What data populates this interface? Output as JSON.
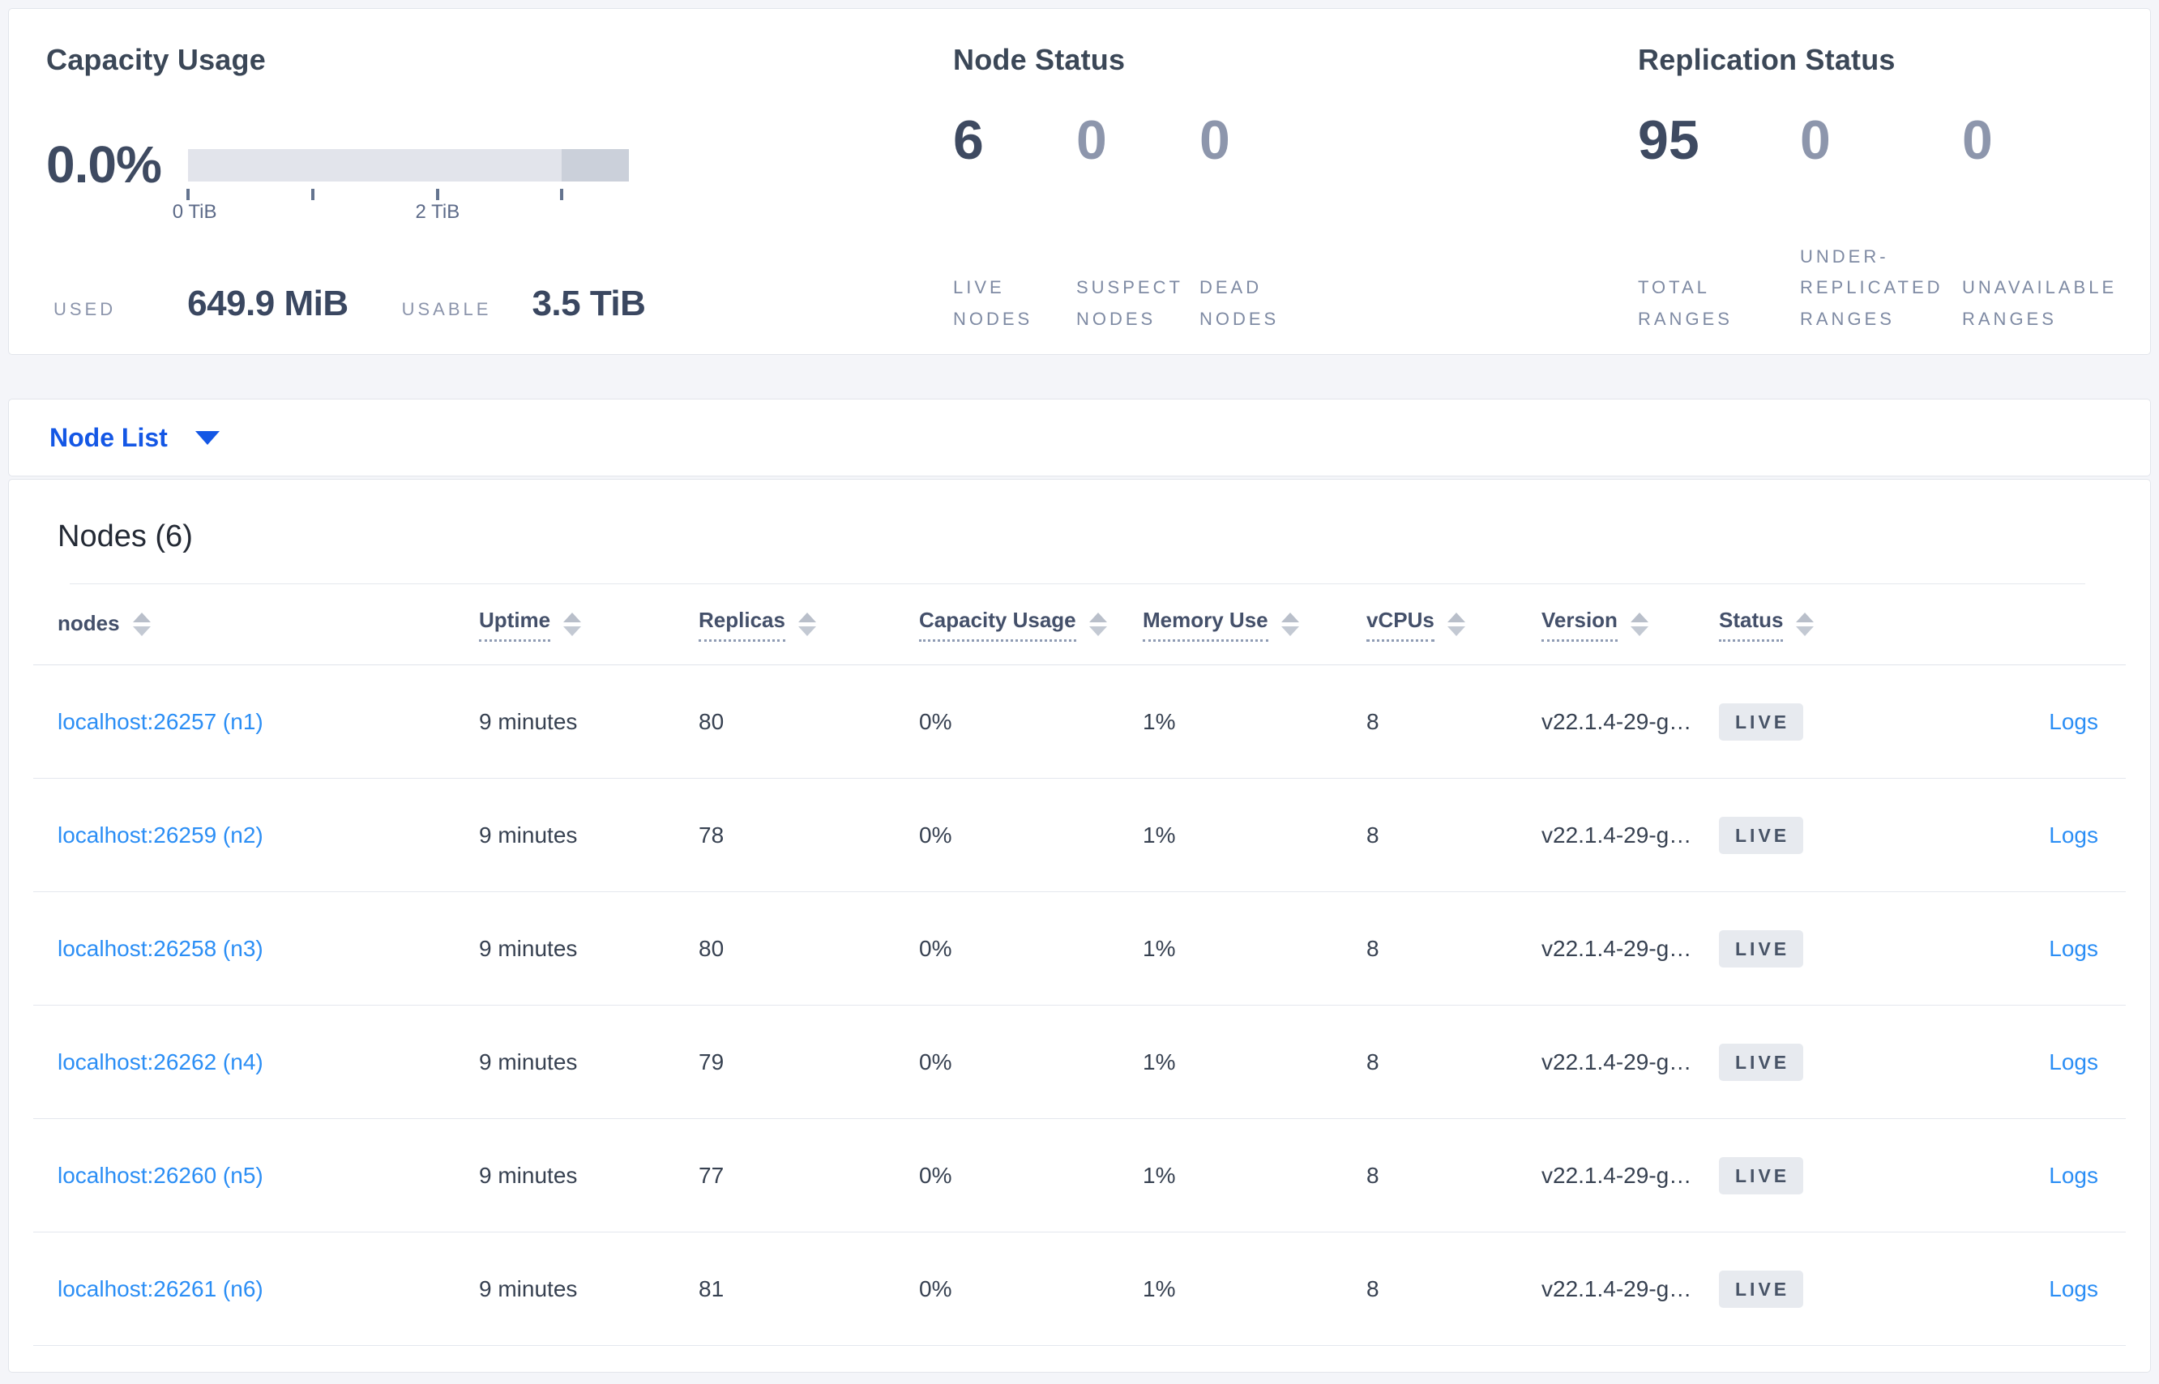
{
  "summary": {
    "capacity": {
      "title": "Capacity Usage",
      "percent": "0.0%",
      "bar": {
        "light_color": "#e2e4eb",
        "dark_color": "#cbd0da",
        "tick_positions_pct": [
          0,
          28.4,
          56.6,
          84.7
        ],
        "tick_labels": [
          {
            "text": "0 TiB",
            "pos_pct": 1.5
          },
          {
            "text": "2 TiB",
            "pos_pct": 56.6
          }
        ]
      },
      "used_label": "USED",
      "used_value": "649.9 MiB",
      "usable_label": "USABLE",
      "usable_value": "3.5 TiB"
    },
    "node_status": {
      "title": "Node Status",
      "stats": [
        {
          "value": "6",
          "label": "LIVE\nNODES",
          "emph": true
        },
        {
          "value": "0",
          "label": "SUSPECT\nNODES",
          "emph": false
        },
        {
          "value": "0",
          "label": "DEAD\nNODES",
          "emph": false
        }
      ]
    },
    "replication": {
      "title": "Replication Status",
      "stats": [
        {
          "value": "95",
          "label": "TOTAL\nRANGES",
          "emph": true
        },
        {
          "value": "0",
          "label": "UNDER-\nREPLICATED\nRANGES",
          "emph": false
        },
        {
          "value": "0",
          "label": "UNAVAILABLE\nRANGES",
          "emph": false
        }
      ]
    }
  },
  "node_list": {
    "dropdown_label": "Node List",
    "accent_color": "#1457e5"
  },
  "table": {
    "heading": "Nodes (6)",
    "columns": [
      {
        "label": "nodes",
        "sortable": true,
        "tooltip": false
      },
      {
        "label": "Uptime",
        "sortable": true,
        "tooltip": true
      },
      {
        "label": "Replicas",
        "sortable": true,
        "tooltip": true
      },
      {
        "label": "Capacity Usage",
        "sortable": true,
        "tooltip": true
      },
      {
        "label": "Memory Use",
        "sortable": true,
        "tooltip": true
      },
      {
        "label": "vCPUs",
        "sortable": true,
        "tooltip": true
      },
      {
        "label": "Version",
        "sortable": true,
        "tooltip": true
      },
      {
        "label": "Status",
        "sortable": true,
        "tooltip": true
      },
      {
        "label": "",
        "sortable": false,
        "tooltip": false
      }
    ],
    "rows": [
      {
        "address": "localhost:26257 (n1)",
        "uptime": "9 minutes",
        "replicas": "80",
        "capacity_usage": "0%",
        "memory_use": "1%",
        "vcpus": "8",
        "version": "v22.1.4-29-g…",
        "status": "LIVE",
        "logs": "Logs"
      },
      {
        "address": "localhost:26259 (n2)",
        "uptime": "9 minutes",
        "replicas": "78",
        "capacity_usage": "0%",
        "memory_use": "1%",
        "vcpus": "8",
        "version": "v22.1.4-29-g…",
        "status": "LIVE",
        "logs": "Logs"
      },
      {
        "address": "localhost:26258 (n3)",
        "uptime": "9 minutes",
        "replicas": "80",
        "capacity_usage": "0%",
        "memory_use": "1%",
        "vcpus": "8",
        "version": "v22.1.4-29-g…",
        "status": "LIVE",
        "logs": "Logs"
      },
      {
        "address": "localhost:26262 (n4)",
        "uptime": "9 minutes",
        "replicas": "79",
        "capacity_usage": "0%",
        "memory_use": "1%",
        "vcpus": "8",
        "version": "v22.1.4-29-g…",
        "status": "LIVE",
        "logs": "Logs"
      },
      {
        "address": "localhost:26260 (n5)",
        "uptime": "9 minutes",
        "replicas": "77",
        "capacity_usage": "0%",
        "memory_use": "1%",
        "vcpus": "8",
        "version": "v22.1.4-29-g…",
        "status": "LIVE",
        "logs": "Logs"
      },
      {
        "address": "localhost:26261 (n6)",
        "uptime": "9 minutes",
        "replicas": "81",
        "capacity_usage": "0%",
        "memory_use": "1%",
        "vcpus": "8",
        "version": "v22.1.4-29-g…",
        "status": "LIVE",
        "logs": "Logs"
      }
    ],
    "status_badge_bg": "#e7eaef",
    "link_color": "#2b8ef5"
  }
}
